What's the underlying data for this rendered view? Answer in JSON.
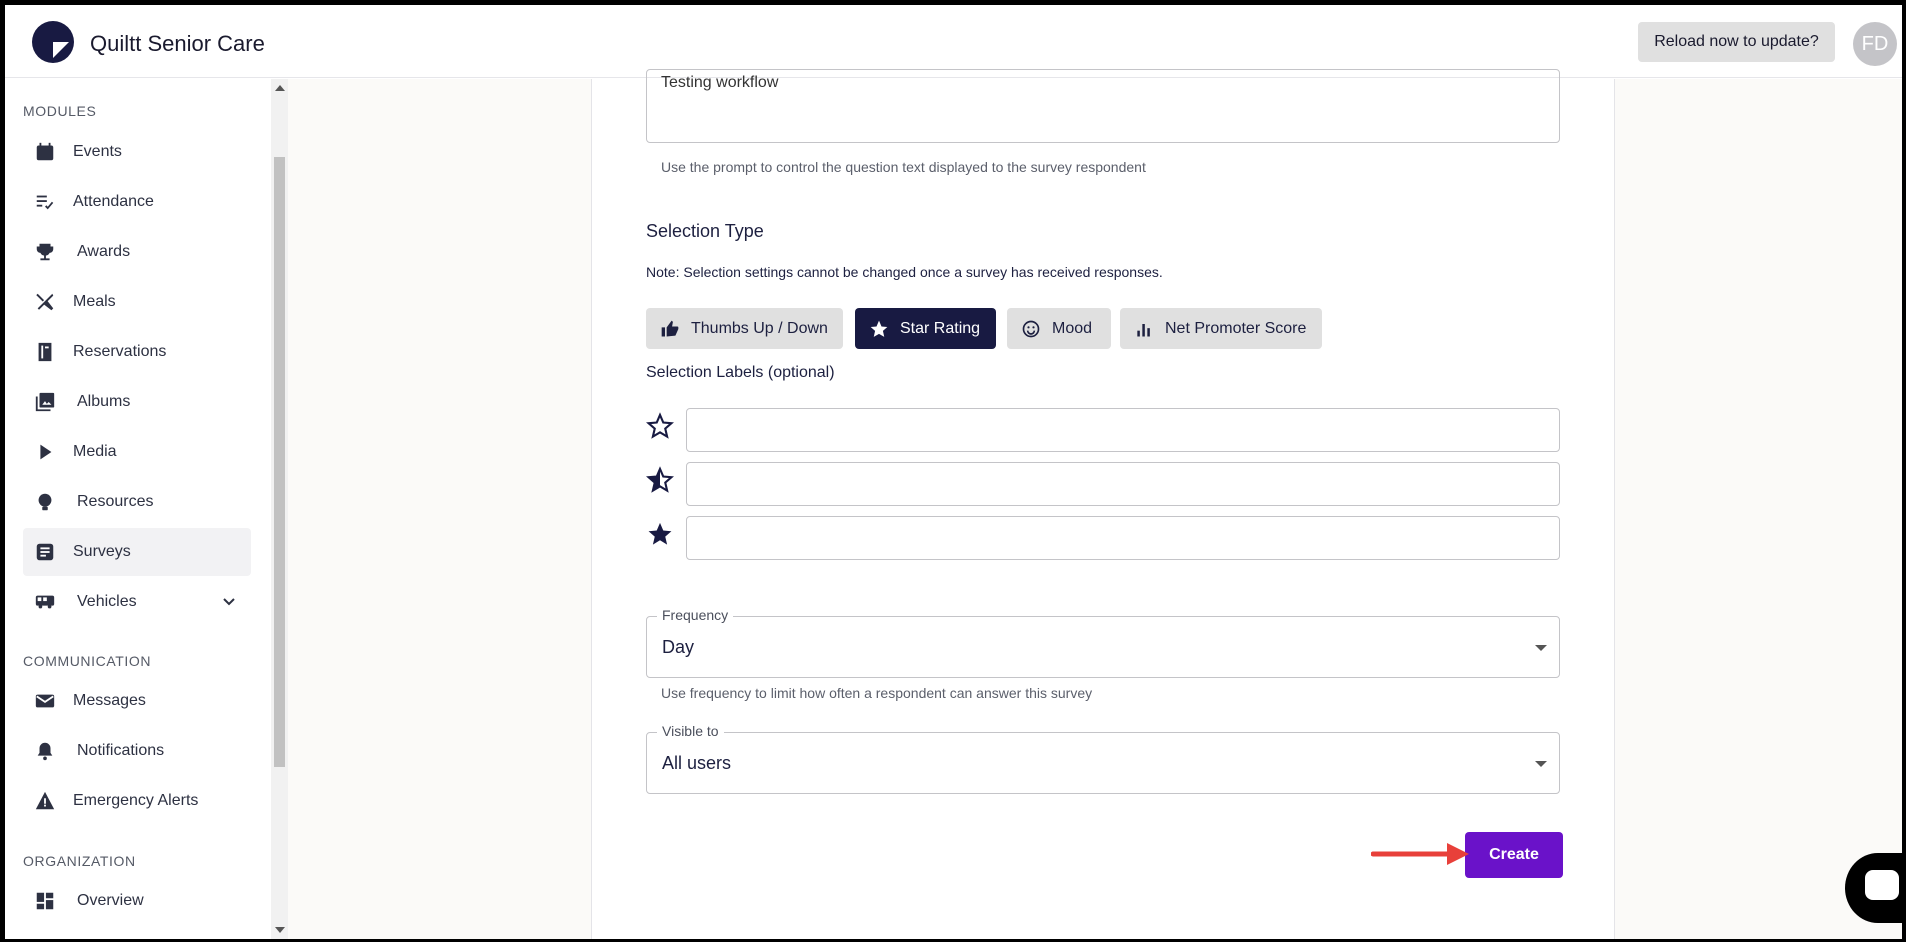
{
  "header": {
    "app_title": "Quiltt Senior Care",
    "reload_label": "Reload now to update?",
    "avatar_initials": "FD"
  },
  "sidebar": {
    "sections": {
      "modules": "MODULES",
      "communication": "COMMUNICATION",
      "organization": "ORGANIZATION"
    },
    "items": [
      {
        "label": "Events",
        "icon": "calendar-icon"
      },
      {
        "label": "Attendance",
        "icon": "checklist-icon"
      },
      {
        "label": "Awards",
        "icon": "trophy-icon"
      },
      {
        "label": "Meals",
        "icon": "utensils-icon"
      },
      {
        "label": "Reservations",
        "icon": "book-icon"
      },
      {
        "label": "Albums",
        "icon": "photo-library-icon"
      },
      {
        "label": "Media",
        "icon": "play-icon"
      },
      {
        "label": "Resources",
        "icon": "lightbulb-icon"
      },
      {
        "label": "Surveys",
        "icon": "survey-icon",
        "active": true
      },
      {
        "label": "Vehicles",
        "icon": "bus-icon"
      },
      {
        "label": "Messages",
        "icon": "mail-icon"
      },
      {
        "label": "Notifications",
        "icon": "bell-icon"
      },
      {
        "label": "Emergency Alerts",
        "icon": "warning-icon"
      },
      {
        "label": "Overview",
        "icon": "dashboard-icon"
      }
    ]
  },
  "form": {
    "prompt_value": "Testing workflow",
    "prompt_helper": "Use the prompt to control the question text displayed to the survey respondent",
    "selection_type_title": "Selection Type",
    "selection_note": "Note: Selection settings cannot be changed once a survey has received responses.",
    "selection_types": [
      {
        "label": "Thumbs Up / Down",
        "icon": "thumbs-up-icon"
      },
      {
        "label": "Star Rating",
        "icon": "star-icon",
        "selected": true
      },
      {
        "label": "Mood",
        "icon": "smiley-icon"
      },
      {
        "label": "Net Promoter Score",
        "icon": "bar-chart-icon"
      }
    ],
    "selection_labels_title": "Selection Labels (optional)",
    "selection_label_inputs": [
      "",
      "",
      ""
    ],
    "frequency": {
      "legend": "Frequency",
      "value": "Day",
      "helper": "Use frequency to limit how often a respondent can answer this survey"
    },
    "visible_to": {
      "legend": "Visible to",
      "value": "All users"
    },
    "create_label": "Create"
  },
  "colors": {
    "accent": "#6a12c9",
    "selected_button": "#181a42",
    "annotation_arrow": "#e8403a"
  }
}
